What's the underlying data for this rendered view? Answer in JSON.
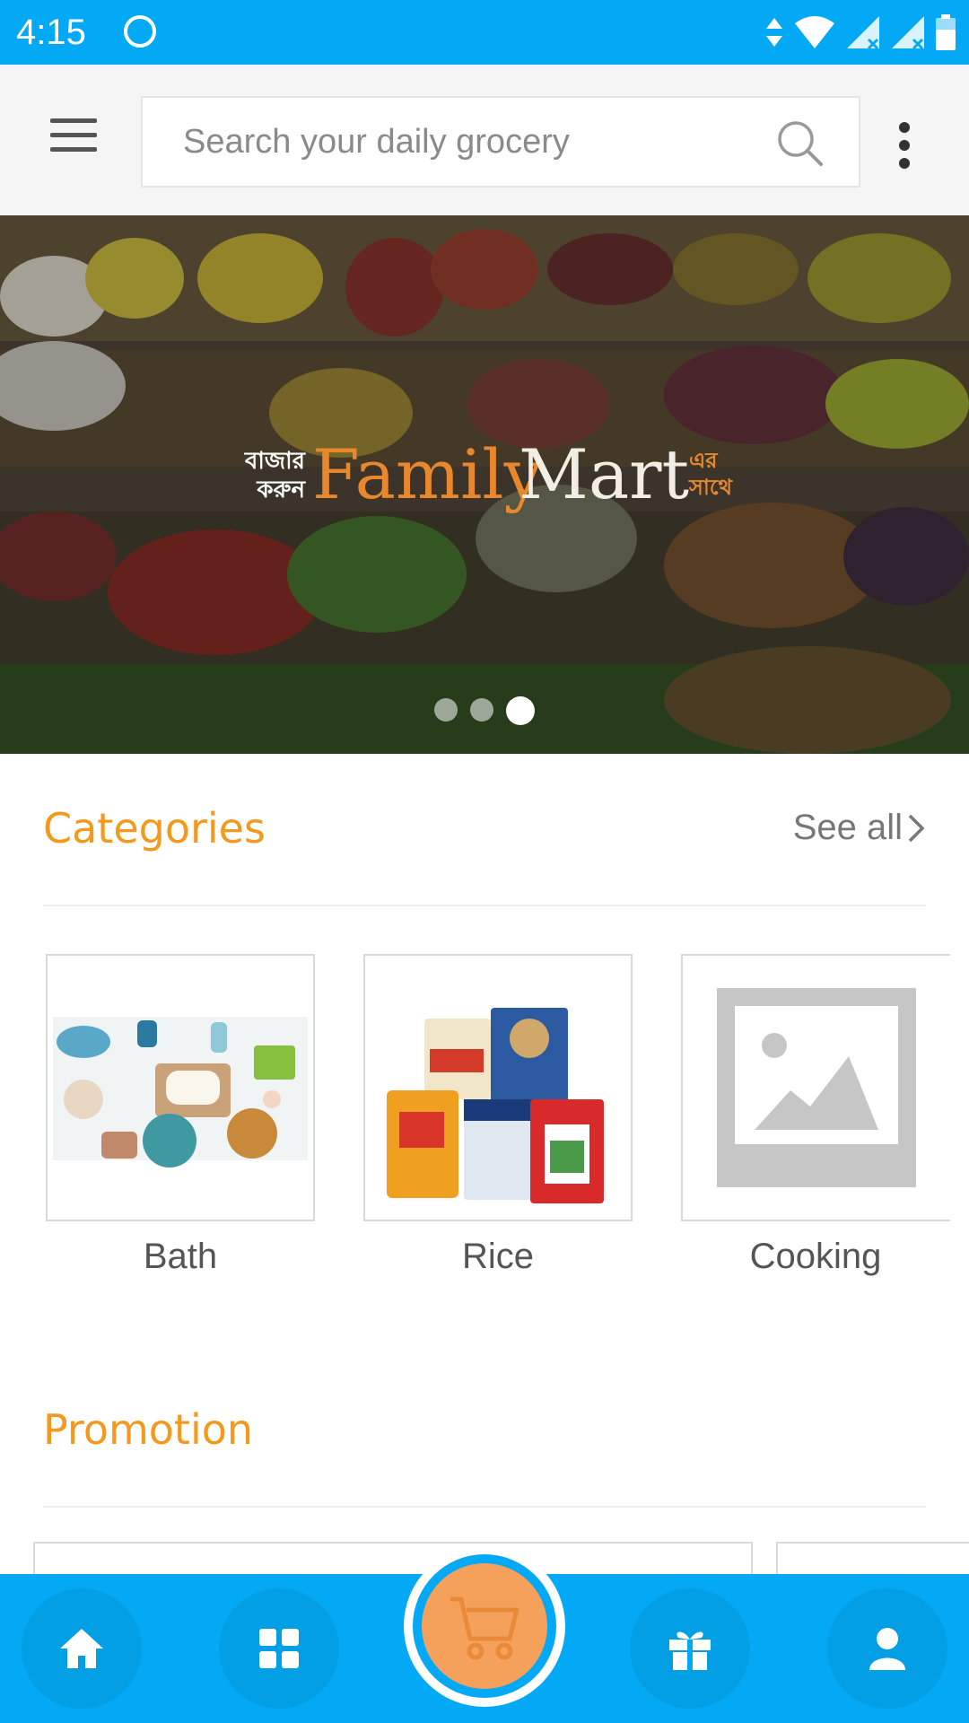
{
  "status_bar": {
    "time": "4:15"
  },
  "toolbar": {
    "search_placeholder": "Search your daily grocery"
  },
  "banner": {
    "logo_bangla_left": "বাজার করুন",
    "logo_text_family": "Family",
    "logo_text_mart": "Mart",
    "logo_bangla_right": "এর সাথে",
    "slide_count": 3,
    "active_slide": 3
  },
  "categories": {
    "title": "Categories",
    "see_all": "See all",
    "items": [
      {
        "label": "Bath"
      },
      {
        "label": "Rice"
      },
      {
        "label": "Cooking"
      }
    ]
  },
  "promotion": {
    "title": "Promotion"
  },
  "bottom_nav": {
    "items": [
      "home-icon",
      "grid-icon",
      "cart-icon",
      "gift-icon",
      "user-icon"
    ]
  },
  "colors": {
    "primary": "#03A9F4",
    "accent": "#F39A1E",
    "cart": "#F6A15B"
  }
}
